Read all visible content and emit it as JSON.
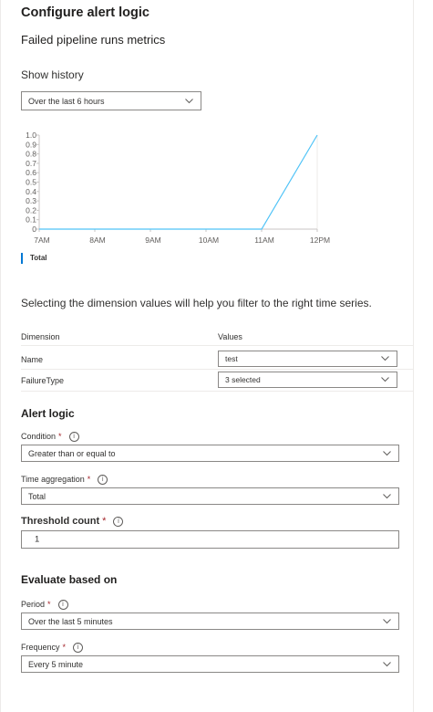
{
  "header": {
    "title": "Configure alert logic",
    "signal": "Failed pipeline runs metrics"
  },
  "history": {
    "label": "Show history",
    "selected": "Over the last 6 hours"
  },
  "chart_data": {
    "type": "line",
    "x": [
      "7AM",
      "8AM",
      "9AM",
      "10AM",
      "11AM",
      "12PM"
    ],
    "y_ticks": [
      "1.0",
      "0.9",
      "0.8",
      "0.7",
      "0.6",
      "0.5",
      "0.4",
      "0.3",
      "0.2",
      "0.1",
      "0"
    ],
    "ylim": [
      0,
      1
    ],
    "series": [
      {
        "name": "Total",
        "points": [
          [
            0,
            0
          ],
          [
            4,
            0
          ],
          [
            5,
            1
          ]
        ],
        "color": "#4fc3f7"
      }
    ],
    "legend": "bottom-left"
  },
  "dimensions": {
    "intro": "Selecting the dimension values will help you filter to the right time series.",
    "col_dimension": "Dimension",
    "col_values": "Values",
    "rows": [
      {
        "name": "Name",
        "value": "test"
      },
      {
        "name": "FailureType",
        "value": "3 selected"
      }
    ]
  },
  "alert_logic": {
    "title": "Alert logic",
    "condition_label": "Condition",
    "condition_value": "Greater than or equal to",
    "aggregation_label": "Time aggregation",
    "aggregation_value": "Total",
    "threshold_label": "Threshold count",
    "threshold_value": "1",
    "required_mark": "*",
    "info_glyph": "i"
  },
  "evaluate": {
    "title": "Evaluate based on",
    "period_label": "Period",
    "period_value": "Over the last 5 minutes",
    "frequency_label": "Frequency",
    "frequency_value": "Every 5 minute"
  },
  "colors": {
    "accent": "#0078d4",
    "series": "#4fc3f7",
    "required": "#a4262c",
    "border": "#8a8886"
  }
}
